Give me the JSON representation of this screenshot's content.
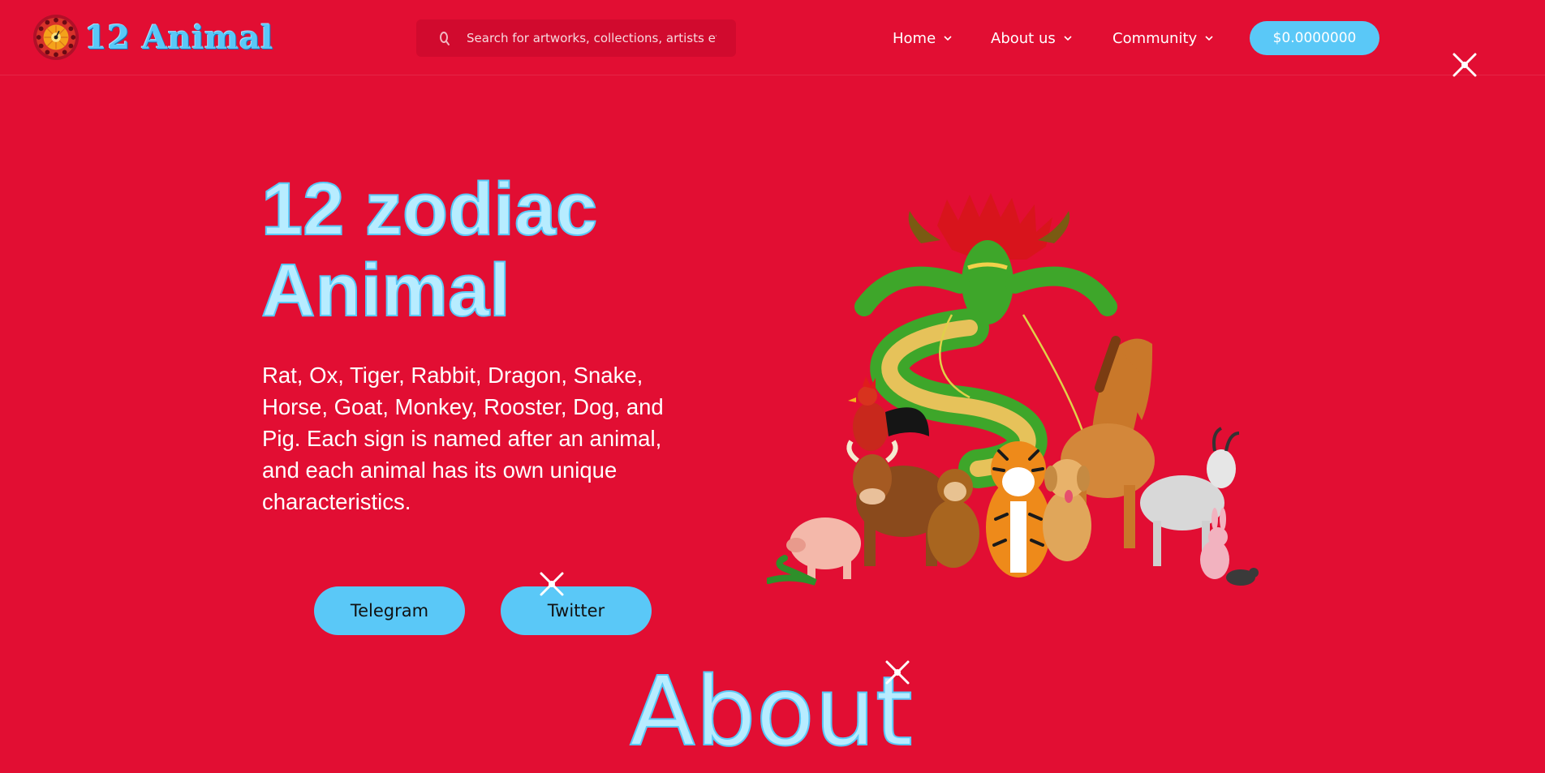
{
  "header": {
    "logo_text": "12 Animal",
    "search": {
      "placeholder": "Search for artworks, collections, artists etc",
      "value": ""
    },
    "nav": {
      "home": "Home",
      "about": "About us",
      "community": "Community"
    },
    "balance": "$0.0000000"
  },
  "hero": {
    "title_line1": "12 zodiac",
    "title_line2": "Animal",
    "description": "Rat, Ox, Tiger, Rabbit, Dragon, Snake, Horse, Goat, Monkey, Rooster, Dog, and Pig. Each sign is named after an animal, and each animal has its own unique characteristics.",
    "buttons": {
      "telegram": "Telegram",
      "twitter": "Twitter"
    }
  },
  "about": {
    "heading": "About"
  },
  "colors": {
    "background": "#e20e33",
    "accent": "#5ac8f7",
    "heading_fill": "#b7ecff",
    "search_bg": "#d10a2e"
  },
  "icons": {
    "search": "search-icon",
    "chevron": "chevron-down-icon",
    "sparkle": "sparkle-icon",
    "logo": "zodiac-wheel-logo"
  },
  "illustration": "zodiac-animals-illustration"
}
